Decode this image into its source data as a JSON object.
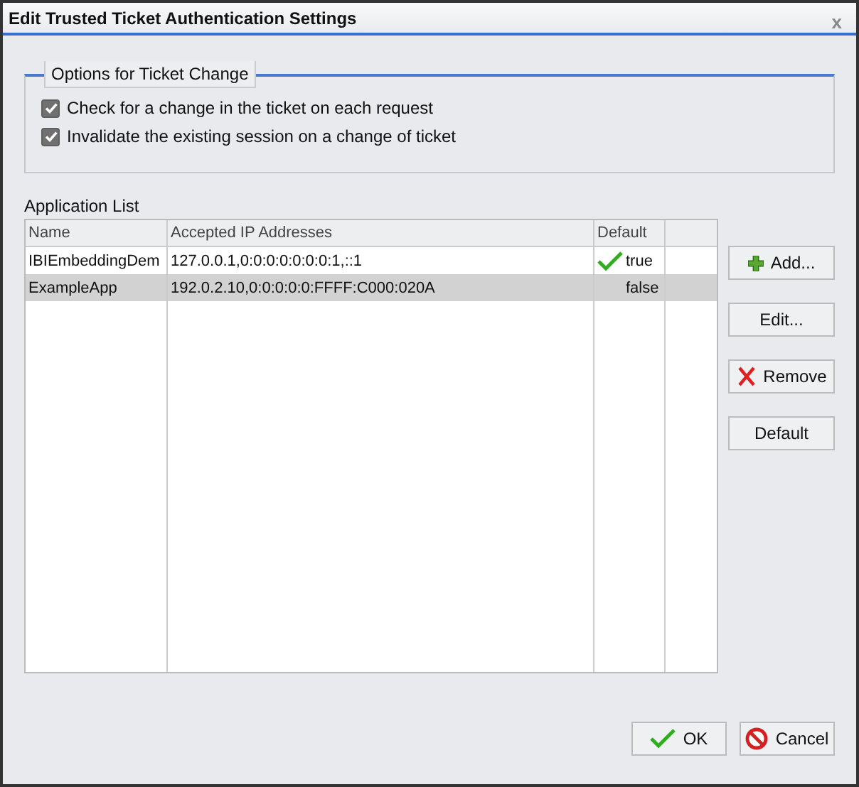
{
  "window": {
    "title": "Edit Trusted Ticket Authentication Settings",
    "close": "x"
  },
  "options_group": {
    "title": "Options for Ticket Change",
    "options": [
      {
        "label": "Check for a change in the ticket on each request",
        "checked": true
      },
      {
        "label": "Invalidate the existing session on a change of ticket",
        "checked": true
      }
    ]
  },
  "application_list": {
    "label": "Application List",
    "columns": [
      "Name",
      "Accepted IP Addresses",
      "Default"
    ],
    "rows": [
      {
        "name": "IBIEmbeddingDem",
        "addresses": "127.0.0.1,0:0:0:0:0:0:0:1,::1",
        "default": "true",
        "default_checked": true,
        "selected": false
      },
      {
        "name": "ExampleApp",
        "addresses": "192.0.2.10,0:0:0:0:0:FFFF:C000:020A",
        "default": "false",
        "default_checked": false,
        "selected": true
      }
    ]
  },
  "side_buttons": [
    {
      "label": "Add...",
      "kind": "add"
    },
    {
      "label": "Edit...",
      "kind": "plain"
    },
    {
      "label": "Remove",
      "kind": "remove"
    },
    {
      "label": "Default",
      "kind": "plain"
    }
  ],
  "footer_buttons": [
    {
      "label": "OK",
      "kind": "ok"
    },
    {
      "label": "Cancel",
      "kind": "cancel"
    }
  ]
}
